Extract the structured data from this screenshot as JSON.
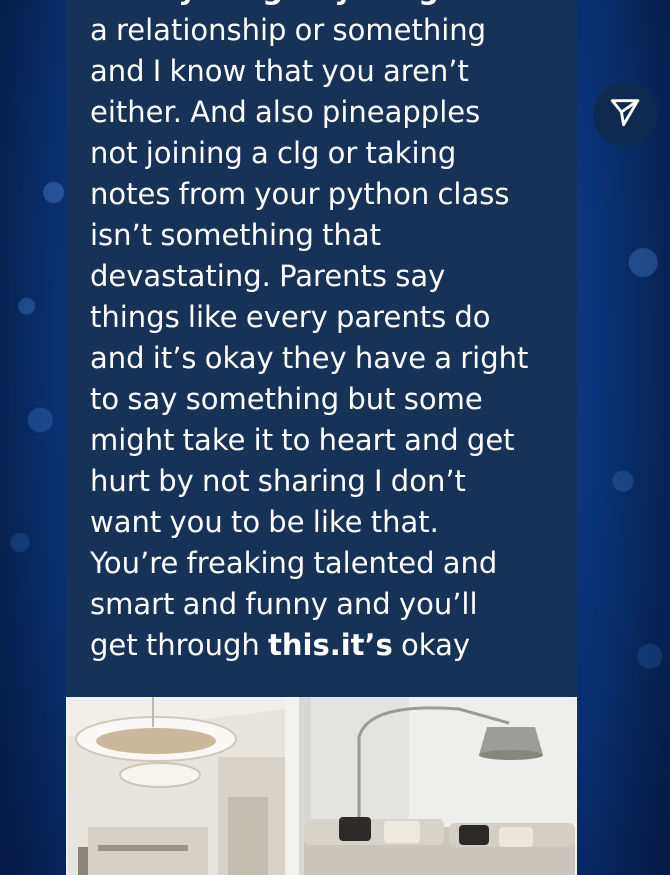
{
  "story": {
    "caption_lines": [
      {
        "parts": [
          {
            "text": "for "
          },
          {
            "text": "anything.anything",
            "bold": true
          },
          {
            "text": " at all be"
          }
        ]
      },
      {
        "parts": [
          {
            "text": "a relationship or something"
          }
        ]
      },
      {
        "parts": [
          {
            "text": "and I know that you aren’t"
          }
        ]
      },
      {
        "parts": [
          {
            "text": "either. And also pineapples"
          }
        ]
      },
      {
        "parts": [
          {
            "text": "not joining a clg or taking"
          }
        ]
      },
      {
        "parts": [
          {
            "text": "notes from your python class"
          }
        ]
      },
      {
        "parts": [
          {
            "text": "isn’t something that"
          }
        ]
      },
      {
        "parts": [
          {
            "text": "devastating. Parents say"
          }
        ]
      },
      {
        "parts": [
          {
            "text": "things like every parents do"
          }
        ]
      },
      {
        "parts": [
          {
            "text": "and it’s okay they have a right"
          }
        ]
      },
      {
        "parts": [
          {
            "text": "to say something but some"
          }
        ]
      },
      {
        "parts": [
          {
            "text": "might take it to heart and get"
          }
        ]
      },
      {
        "parts": [
          {
            "text": "hurt by not sharing I don’t"
          }
        ]
      },
      {
        "parts": [
          {
            "text": "want you to be like that."
          }
        ]
      },
      {
        "parts": [
          {
            "text": "You’re freaking talented and"
          }
        ]
      },
      {
        "parts": [
          {
            "text": "smart and funny and you’ll"
          }
        ]
      },
      {
        "parts": [
          {
            "text": "get through "
          },
          {
            "text": "this.it’s",
            "bold": true
          },
          {
            "text": " okay"
          }
        ]
      }
    ]
  },
  "colors": {
    "card_background": "#163357",
    "share_button": "#0f2a4f",
    "text": "#ffffff"
  },
  "icons": {
    "share": "paper-plane-icon"
  }
}
